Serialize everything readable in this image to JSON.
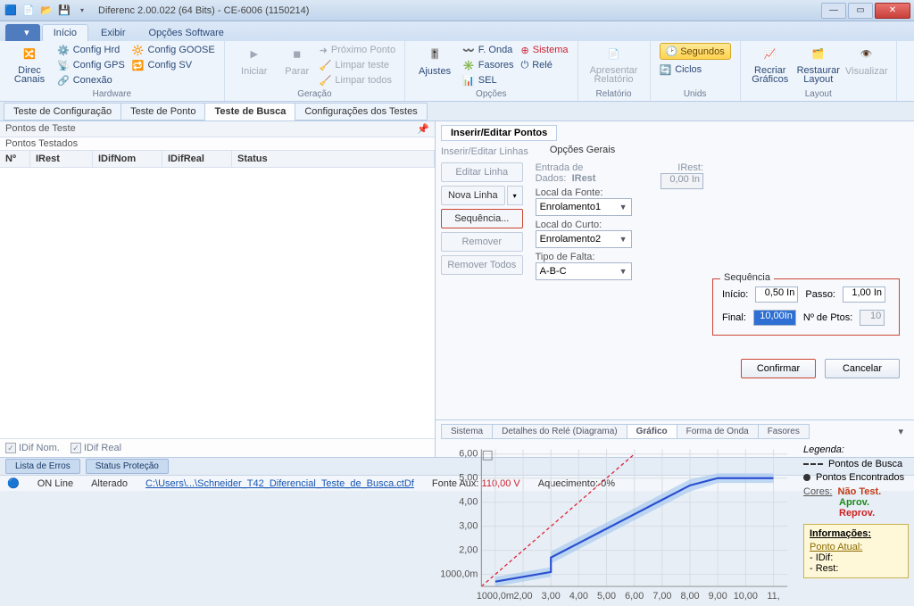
{
  "title": "Diferenc 2.00.022 (64 Bits) - CE-6006 (1150214)",
  "ribbon_tabs": {
    "file": "",
    "inicio": "Início",
    "exibir": "Exibir",
    "opcoes": "Opções Software"
  },
  "ribbon": {
    "hardware": {
      "config_hrd": "Config Hrd",
      "config_goose": "Config GOOSE",
      "config_gps": "Config GPS",
      "config_sv": "Config SV",
      "direc_canais": "Direc Canais",
      "conexao": "Conexão",
      "group": "Hardware"
    },
    "geracao": {
      "iniciar": "Iniciar",
      "parar": "Parar",
      "proximo": "Próximo Ponto",
      "limpar_teste": "Limpar teste",
      "limpar_todos": "Limpar todos",
      "group": "Geração"
    },
    "opcoes": {
      "ajustes": "Ajustes",
      "fonda": "F. Onda",
      "fasores": "Fasores",
      "sel": "SEL",
      "sistema": "Sistema",
      "rele": "Relé",
      "group": "Opções"
    },
    "relatorio": {
      "apresentar": "Apresentar Relatório",
      "group": "Relatório"
    },
    "unids": {
      "segundos": "Segundos",
      "ciclos": "Ciclos",
      "group": "Unids"
    },
    "layout": {
      "recriar": "Recriar Gráficos",
      "restaurar": "Restaurar Layout",
      "visualizar": "Visualizar",
      "group": "Layout"
    }
  },
  "subtabs": {
    "t1": "Teste de Configuração",
    "t2": "Teste de Ponto",
    "t3": "Teste de Busca",
    "t4": "Configurações dos Testes"
  },
  "left": {
    "title": "Pontos de Teste",
    "subtitle": "Pontos Testados",
    "cols": {
      "n": "Nº",
      "irest": "IRest",
      "idifnom": "IDifNom",
      "idifreal": "IDifReal",
      "status": "Status"
    },
    "foot": {
      "idifnom": "IDif Nom.",
      "idifreal": "IDif Real"
    }
  },
  "ins": {
    "tab1": "Inserir/Editar Pontos",
    "tab2": "Inserir/Editar Linhas",
    "opg": "Opções Gerais",
    "entrada": "Entrada de Dados:",
    "entrada_v": "IRest",
    "irest_lbl": "IRest:",
    "irest_v": "0,00 In",
    "editar": "Editar Linha",
    "nova": "Nova Linha",
    "seq": "Sequência...",
    "remover": "Remover",
    "remtodos": "Remover Todos",
    "local_fonte": "Local da Fonte:",
    "fonte_v": "Enrolamento1",
    "local_curto": "Local do Curto:",
    "curto_v": "Enrolamento2",
    "tipo_falta": "Tipo de Falta:",
    "falta_v": "A-B-C",
    "seqbox": {
      "title": "Sequência",
      "inicio_l": "Início:",
      "inicio_v": "0,50 In",
      "passo_l": "Passo:",
      "passo_v": "1,00 In",
      "final_l": "Final:",
      "final_v": "10,00In",
      "nptos_l": "Nº de Ptos:",
      "nptos_v": "10"
    },
    "confirmar": "Confirmar",
    "cancelar": "Cancelar"
  },
  "chart": {
    "tabs": {
      "sistema": "Sistema",
      "detalhes": "Detalhes do Relé (Diagrama)",
      "grafico": "Gráfico",
      "onda": "Forma de Onda",
      "fasores": "Fasores"
    },
    "legend": {
      "title": "Legenda:",
      "pb": "Pontos de Busca",
      "pe": "Pontos Encontrados",
      "cores": "Cores:",
      "nt": "Não Test.",
      "ap": "Aprov.",
      "rp": "Reprov.",
      "info": "Informações:",
      "pa": "Ponto Atual:",
      "idif": "- IDif:",
      "rest": "- Rest:"
    }
  },
  "bottom": {
    "erros": "Lista de Erros",
    "prot": "Status Proteção"
  },
  "status": {
    "on": "ON Line",
    "alt": "Alterado",
    "file": "C:\\Users\\...\\Schneider_T42_Diferencial_Teste_de_Busca.ctDf",
    "fonte": "Fonte Aux:",
    "fonte_v": "110,00 V",
    "aquec": "Aquecimento:",
    "aquec_v": "0%"
  },
  "chart_data": {
    "type": "line",
    "xlabel": "",
    "ylabel": "",
    "xlim": [
      0.5,
      11.5
    ],
    "ylim": [
      0.5,
      6.2
    ],
    "xticks": [
      "1000,0m",
      "2,00",
      "3,00",
      "4,00",
      "5,00",
      "6,00",
      "7,00",
      "8,00",
      "9,00",
      "10,00",
      "11,"
    ],
    "yticks": [
      "1000,0m",
      "2,00",
      "3,00",
      "4,00",
      "5,00",
      "6,00"
    ],
    "series": [
      {
        "name": "char_blue",
        "color": "#2a4fd1",
        "x": [
          1,
          2,
          3,
          3,
          4,
          5,
          6,
          7,
          8,
          9,
          10,
          11
        ],
        "y": [
          0.7,
          0.9,
          1.1,
          1.7,
          2.3,
          2.9,
          3.5,
          4.1,
          4.7,
          5.0,
          5.0,
          5.0
        ]
      },
      {
        "name": "unity_red_dashed",
        "color": "#d23",
        "dash": true,
        "x": [
          0.5,
          6.0
        ],
        "y": [
          0.5,
          6.0
        ]
      }
    ],
    "band": {
      "color": "#9fc5ef",
      "x": [
        1,
        2,
        3,
        3,
        4,
        5,
        6,
        7,
        8,
        9,
        10,
        11
      ],
      "yhi": [
        0.9,
        1.1,
        1.3,
        1.95,
        2.55,
        3.15,
        3.75,
        4.35,
        4.95,
        5.2,
        5.2,
        5.2
      ],
      "ylo": [
        0.5,
        0.7,
        0.9,
        1.45,
        2.05,
        2.65,
        3.25,
        3.85,
        4.45,
        4.8,
        4.8,
        4.8
      ]
    }
  }
}
